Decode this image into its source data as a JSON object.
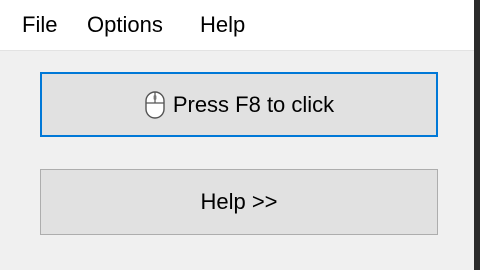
{
  "menubar": {
    "items": [
      {
        "label": "File"
      },
      {
        "label": "Options"
      },
      {
        "label": "Help"
      }
    ]
  },
  "main": {
    "click_button": {
      "label": "Press F8 to click",
      "icon": "mouse-icon",
      "focused": true,
      "focus_color": "#0078d7"
    },
    "help_button": {
      "label": "Help >>"
    }
  }
}
